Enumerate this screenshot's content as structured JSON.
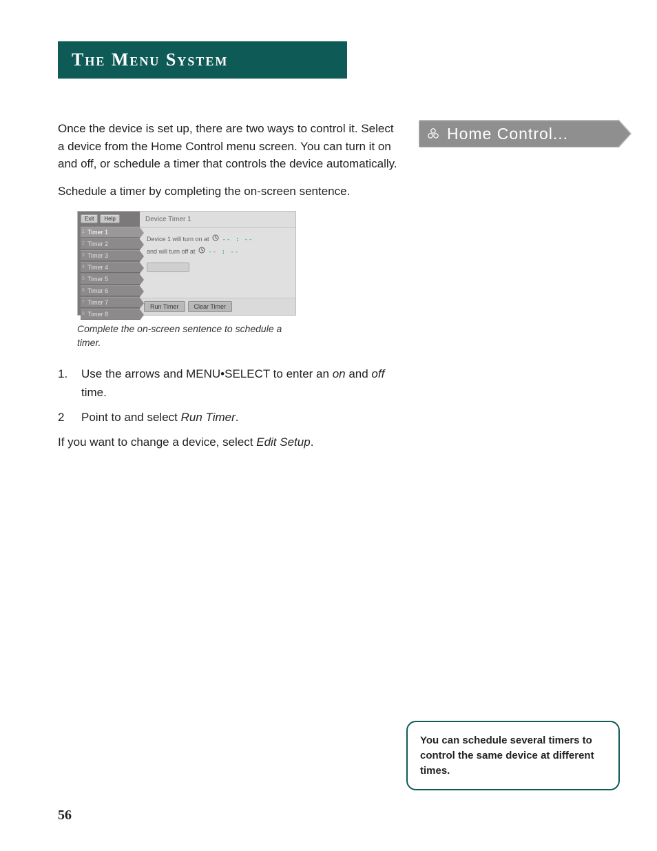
{
  "section_title": "The Menu System",
  "intro_paragraph": "Once the device is set up, there are two ways to control it. Select a device from the Home Control menu screen. You can turn it on and off, or schedule a timer that controls the device automatically.",
  "schedule_paragraph": "Schedule a timer by completing the on-screen sentence.",
  "home_control_chip": "Home Control...",
  "osd": {
    "exit": "Exit",
    "help": "Help",
    "tabs": [
      "Timer 1",
      "Timer 2",
      "Timer 3",
      "Timer 4",
      "Timer 5",
      "Timer 6",
      "Timer 7",
      "Timer 8"
    ],
    "tab_indices": [
      "1",
      "2",
      "3",
      "4",
      "5",
      "6",
      "7",
      "8"
    ],
    "title": "Device Timer 1",
    "line1_pre": "Device 1 will turn on at ",
    "line2_pre": "and will turn off at ",
    "time_placeholder": "-- : --",
    "run_timer": "Run Timer",
    "clear_timer": "Clear Timer"
  },
  "caption": "Complete the on-screen sentence to schedule a timer.",
  "steps": {
    "s1_num": "1.",
    "s1_a": "Use the arrows and MENU•SELECT to enter an ",
    "s1_on": "on",
    "s1_b": " and ",
    "s1_off": "off",
    "s1_c": " time.",
    "s2_num": "2",
    "s2_a": "Point to and select ",
    "s2_run": "Run Timer",
    "s2_b": "."
  },
  "closing_a": "If you want to change a device, select ",
  "closing_em": "Edit Setup",
  "closing_b": ".",
  "tip": "You can schedule several timers to control the same device at different times.",
  "page_number": "56"
}
